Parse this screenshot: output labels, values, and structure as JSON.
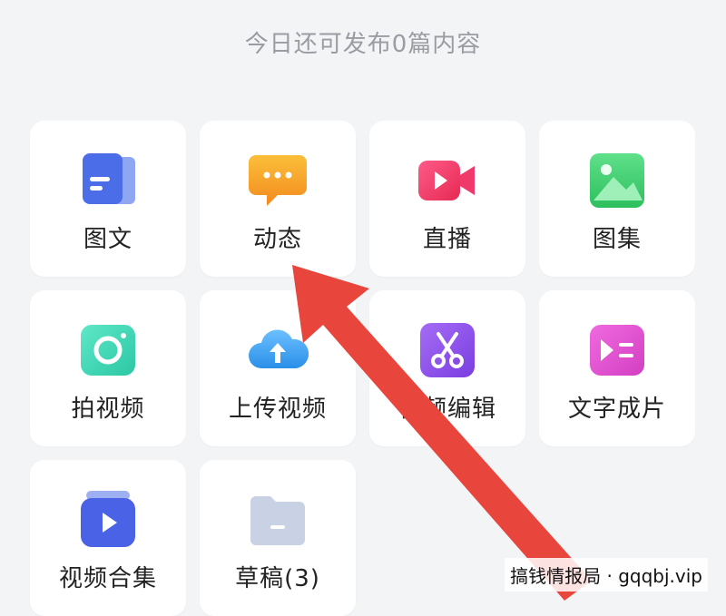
{
  "header": {
    "quota_text": "今日还可发布0篇内容"
  },
  "tiles": [
    {
      "label": "图文",
      "icon": "article-icon",
      "color": "#4b6ee8"
    },
    {
      "label": "动态",
      "icon": "chat-bubble-icon",
      "color": "#f5a623"
    },
    {
      "label": "直播",
      "icon": "live-camera-icon",
      "color": "#f0386b"
    },
    {
      "label": "图集",
      "icon": "image-gallery-icon",
      "color": "#3ccf6e"
    },
    {
      "label": "拍视频",
      "icon": "camera-icon",
      "color": "#3cd6b4"
    },
    {
      "label": "上传视频",
      "icon": "cloud-upload-icon",
      "color": "#3aa3f2"
    },
    {
      "label": "视频编辑",
      "icon": "scissors-icon",
      "color": "#8a4de8"
    },
    {
      "label": "文字成片",
      "icon": "text-to-video-icon",
      "color": "#e64fd2"
    },
    {
      "label": "视频合集",
      "icon": "video-collection-icon",
      "color": "#4a63e6"
    },
    {
      "label": "草稿(3)",
      "icon": "folder-icon",
      "color": "#c9d1e4"
    }
  ],
  "watermark": {
    "text": "搞钱情报局 · gqqbj.vip"
  },
  "annotation": {
    "arrow_color": "#e8453c"
  }
}
